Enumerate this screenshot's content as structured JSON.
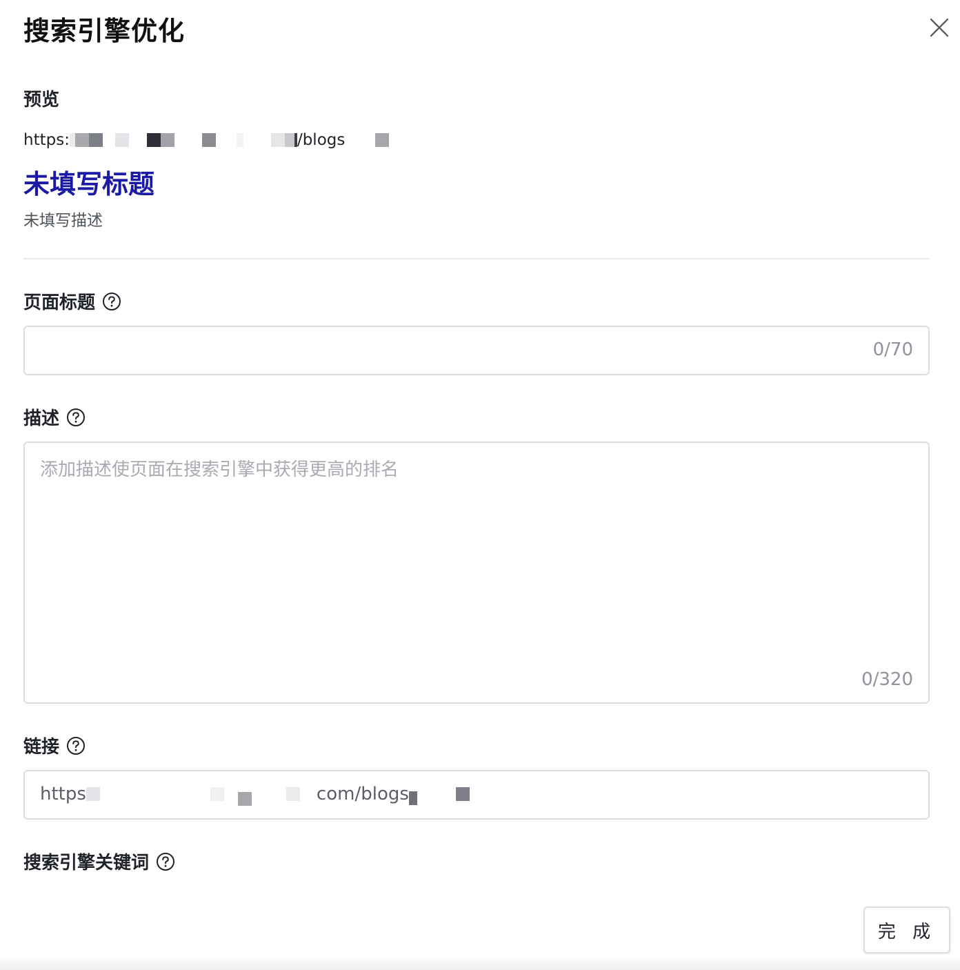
{
  "dialog": {
    "title": "搜索引擎优化",
    "close_icon": "close-icon"
  },
  "preview": {
    "label": "预览",
    "url_prefix": "https:",
    "url_path": "/blogs",
    "title": "未填写标题",
    "description": "未填写描述"
  },
  "fields": {
    "page_title": {
      "label": "页面标题",
      "value": "",
      "counter": "0/70"
    },
    "description": {
      "label": "描述",
      "value": "",
      "placeholder": "添加描述使页面在搜索引擎中获得更高的排名",
      "counter": "0/320"
    },
    "link": {
      "label": "链接",
      "value_prefix": "https",
      "value_path": "com/blogs"
    },
    "keywords": {
      "label": "搜索引擎关键词"
    }
  },
  "footer": {
    "done_label": "完 成"
  },
  "colors": {
    "title_link": "#1a1aa6",
    "border": "#dcdde3",
    "placeholder": "#a8abb2",
    "counter": "#8f939c",
    "divider": "#e7e8eb"
  }
}
